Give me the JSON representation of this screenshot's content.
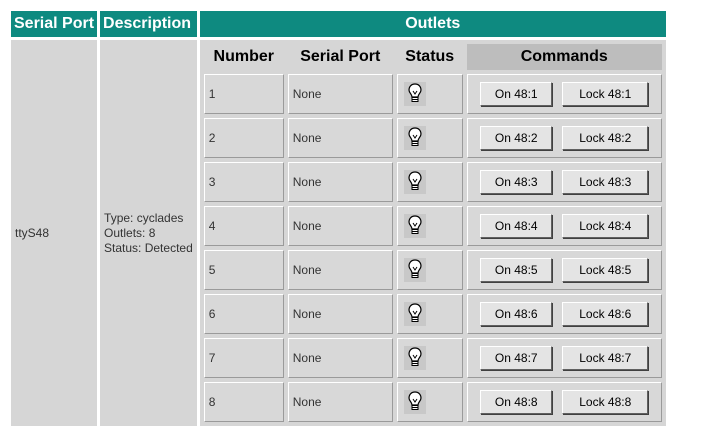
{
  "header": {
    "serial_port": "Serial Port",
    "description": "Description",
    "outlets": "Outlets"
  },
  "device": {
    "port": "ttyS48",
    "description": [
      "Type: cyclades",
      "Outlets: 8",
      "Status: Detected"
    ]
  },
  "outlets_table": {
    "columns": {
      "number": "Number",
      "serial_port": "Serial Port",
      "status": "Status",
      "commands": "Commands"
    },
    "rows": [
      {
        "number": "1",
        "serial_port": "None",
        "status_icon": "lightbulb-icon",
        "on_label": "On 48:1",
        "lock_label": "Lock 48:1"
      },
      {
        "number": "2",
        "serial_port": "None",
        "status_icon": "lightbulb-icon",
        "on_label": "On 48:2",
        "lock_label": "Lock 48:2"
      },
      {
        "number": "3",
        "serial_port": "None",
        "status_icon": "lightbulb-icon",
        "on_label": "On 48:3",
        "lock_label": "Lock 48:3"
      },
      {
        "number": "4",
        "serial_port": "None",
        "status_icon": "lightbulb-icon",
        "on_label": "On 48:4",
        "lock_label": "Lock 48:4"
      },
      {
        "number": "5",
        "serial_port": "None",
        "status_icon": "lightbulb-icon",
        "on_label": "On 48:5",
        "lock_label": "Lock 48:5"
      },
      {
        "number": "6",
        "serial_port": "None",
        "status_icon": "lightbulb-icon",
        "on_label": "On 48:6",
        "lock_label": "Lock 48:6"
      },
      {
        "number": "7",
        "serial_port": "None",
        "status_icon": "lightbulb-icon",
        "on_label": "On 48:7",
        "lock_label": "Lock 48:7"
      },
      {
        "number": "8",
        "serial_port": "None",
        "status_icon": "lightbulb-icon",
        "on_label": "On 48:8",
        "lock_label": "Lock 48:8"
      }
    ]
  },
  "colors": {
    "header_bg": "#0e8a80",
    "header_text": "#ffffff",
    "cell_bg": "#d6d6d6",
    "commands_header_bg": "#bdbdbd"
  }
}
